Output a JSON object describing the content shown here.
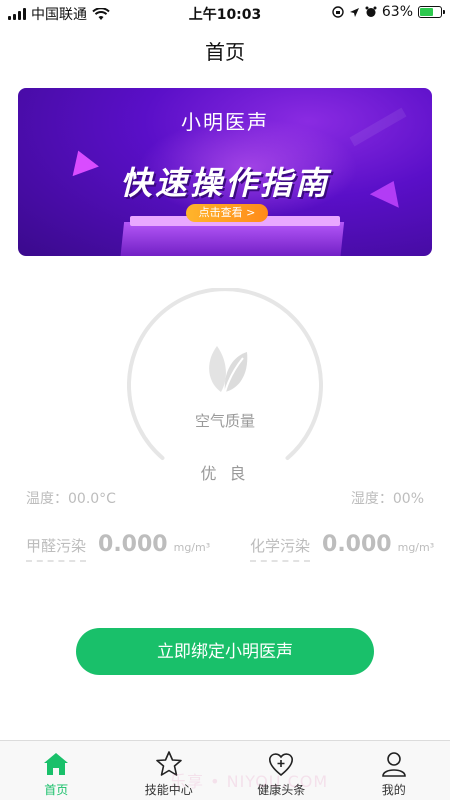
{
  "status_bar": {
    "carrier": "中国联通",
    "time": "上午10:03",
    "battery_percent": "63%",
    "battery_level": 0.63
  },
  "header": {
    "title": "首页"
  },
  "banner": {
    "subtitle": "小明医声",
    "title": "快速操作指南",
    "button_label": "点击查看 >"
  },
  "air_quality": {
    "label": "空气质量",
    "value": "优 良",
    "temperature": "温度：00.0°C",
    "humidity": "湿度：00%",
    "formaldehyde": {
      "label": "甲醛污染",
      "value": "0.000",
      "unit": "mg/m³"
    },
    "chemical": {
      "label": "化学污染",
      "value": "0.000",
      "unit": "mg/m³"
    }
  },
  "bind_button": {
    "label": "立即绑定小明医声"
  },
  "tabbar": {
    "tabs": [
      {
        "label": "首页",
        "icon": "home-icon",
        "active": true
      },
      {
        "label": "技能中心",
        "icon": "star-icon",
        "active": false
      },
      {
        "label": "健康头条",
        "icon": "heart-plus-icon",
        "active": false
      },
      {
        "label": "我的",
        "icon": "person-icon",
        "active": false
      }
    ]
  },
  "watermark": "乐享 • NIYOU.COM",
  "colors": {
    "accent": "#19c06a",
    "banner_purple": "#5a0fc8",
    "muted": "#bdbdbd"
  }
}
